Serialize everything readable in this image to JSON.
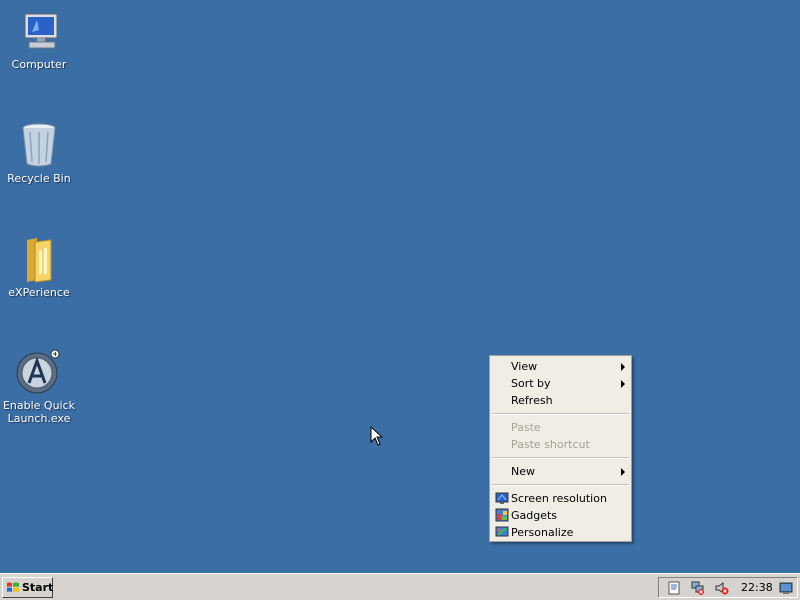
{
  "desktop": {
    "icons": [
      {
        "label": "Computer",
        "icon": "computer-icon"
      },
      {
        "label": "Recycle Bin",
        "icon": "recycle-bin-icon"
      },
      {
        "label": "eXPerience",
        "icon": "folder-icon"
      },
      {
        "label": "Enable Quick\nLaunch.exe",
        "icon": "quick-launch-icon"
      }
    ]
  },
  "context_menu": {
    "items": [
      {
        "label": "View",
        "submenu": true
      },
      {
        "label": "Sort by",
        "submenu": true
      },
      {
        "label": "Refresh"
      },
      {
        "label": "Paste",
        "disabled": true
      },
      {
        "label": "Paste shortcut",
        "disabled": true
      },
      {
        "label": "New",
        "submenu": true
      },
      {
        "label": "Screen resolution",
        "icon": "screen-resolution-icon"
      },
      {
        "label": "Gadgets",
        "icon": "gadgets-icon"
      },
      {
        "label": "Personalize",
        "icon": "personalize-icon"
      }
    ]
  },
  "taskbar": {
    "start_label": "Start",
    "clock": "22:38"
  },
  "colors": {
    "desktop_bg": "#3a6ea5",
    "menu_bg": "#f0eee4",
    "taskbar_bg": "#d6d3ce"
  }
}
